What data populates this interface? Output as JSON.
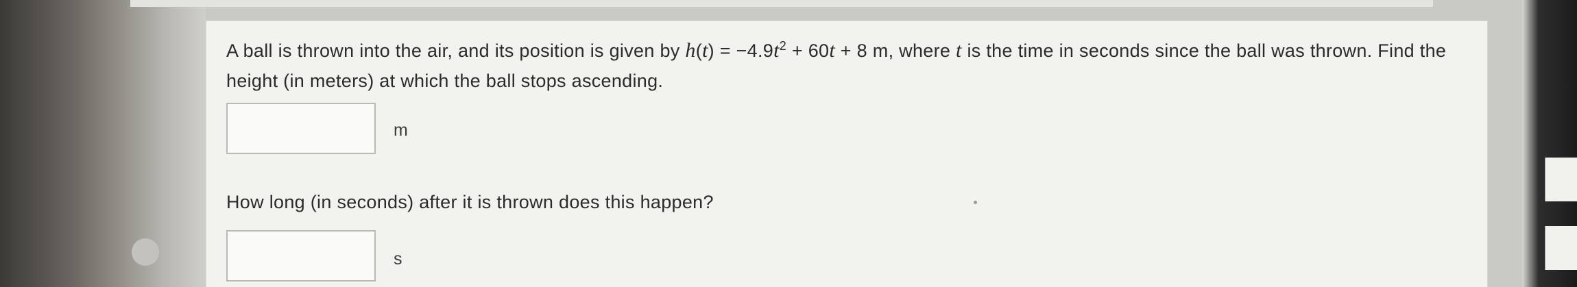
{
  "question": {
    "p1": "A ball is thrown into the air, and its position is given by ",
    "fn": "h",
    "arg": "t",
    "eq_part1": " = −4.9",
    "t_var": "t",
    "exp": "2",
    "eq_part2": " + 60",
    "t_var2": "t",
    "eq_part3": " + 8 m, where ",
    "t_var3": "t",
    "p2": " is the time in seconds since the ball was thrown. Find the height (in meters) at which the ball stops ascending."
  },
  "answer1": {
    "value": "",
    "unit": "m"
  },
  "question2": {
    "text": "How long (in seconds) after it is thrown does this happen?"
  },
  "answer2": {
    "value": "",
    "unit": "s"
  }
}
